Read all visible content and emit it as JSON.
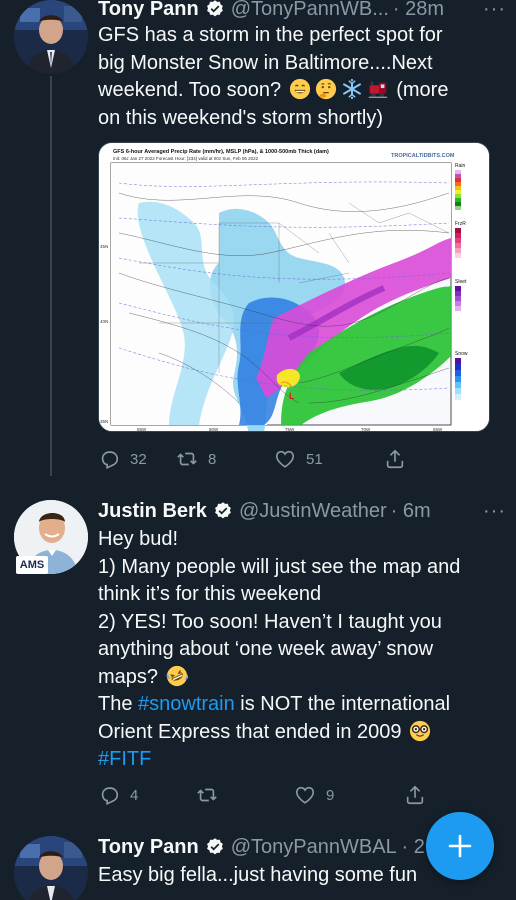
{
  "tweets": [
    {
      "name": "Tony Pann",
      "handle": "@TonyPannWB...",
      "time": "· 28m",
      "text_line1": "GFS has a storm in the perfect spot for",
      "text_line2": "big Monster Snow in Baltimore....Next",
      "text_line3a": "weekend. Too soon? ",
      "text_line3b": " (more",
      "text_line4": "on this weekend's storm shortly)",
      "replies": "32",
      "retweets": "8",
      "likes": "51",
      "media": {
        "title": "GFS 6-hour Averaged Precip Rate (mm/hr), MSLP (hPa), & 1000-500mb Thick (dam)",
        "subtitle": "Init: 06z Jan 27 2022   Forecast Hour: [234]   valid at 00z Sun, Feb 06 2022",
        "watermark": "TROPICALTIDBITS.COM",
        "legend": [
          "Rain",
          "FrzR",
          "Sleet",
          "Snow"
        ],
        "lat_labels": [
          "45N",
          "40N",
          "35N"
        ],
        "lon_labels": [
          "85W",
          "80W",
          "75W",
          "70W",
          "65W"
        ]
      }
    },
    {
      "name": "Justin Berk",
      "handle": "@JustinWeather",
      "time": "· 6m",
      "badge": "AMS",
      "line1": "Hey bud!",
      "line2": "1) Many people will just see the map and",
      "line3": "think it’s for this weekend",
      "line4": "2) YES! Too soon! Haven’t I taught you",
      "line5": "anything about ‘one week away’ snow",
      "line6": "maps? ",
      "line7a": "The ",
      "line7_link": "#snowtrain",
      "line7b": " is NOT the international",
      "line8": "Orient Express that ended in 2009 ",
      "line9_link": "#FITF",
      "replies": "4",
      "retweets": "",
      "likes": "9"
    },
    {
      "name": "Tony Pann",
      "handle": "@TonyPannWBAL · 2",
      "text": "Easy big fella...just having some fun"
    }
  ],
  "more_label": "···",
  "colors": {
    "background": "#15202b",
    "accent": "#1d9bf0",
    "muted": "#8b98a5",
    "divider": "#38444d"
  },
  "icons": [
    "verified-icon",
    "reply-icon",
    "retweet-icon",
    "like-icon",
    "share-icon",
    "compose-plus-icon"
  ]
}
